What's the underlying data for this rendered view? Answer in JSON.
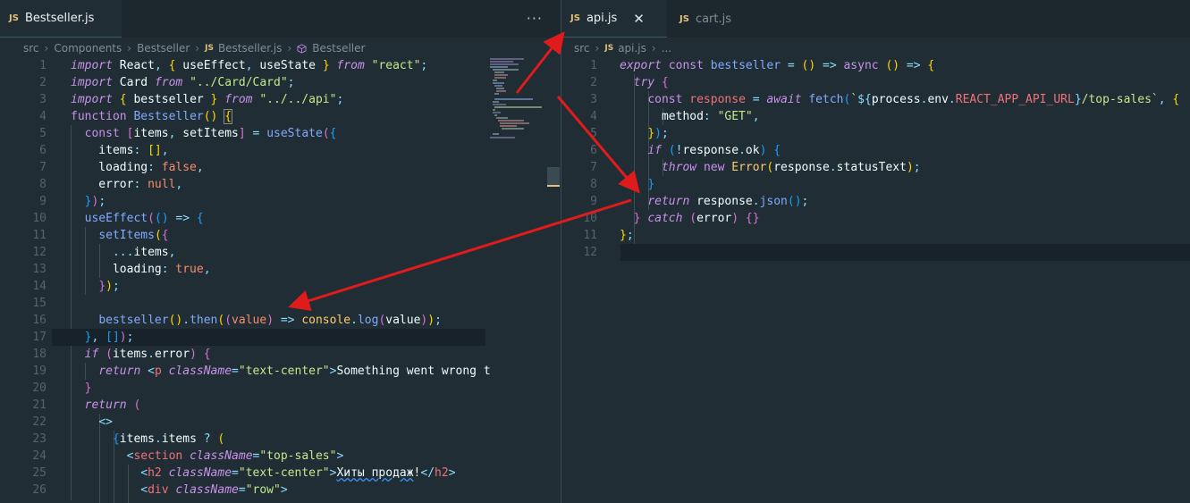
{
  "left_editor": {
    "tabs": [
      {
        "label": "Bestseller.js",
        "icon": "JS"
      }
    ],
    "more_actions": "···",
    "breadcrumb": [
      "src",
      "Components",
      "Bestseller",
      "Bestseller.js",
      "Bestseller"
    ],
    "line_numbers": [
      "1",
      "2",
      "3",
      "4",
      "5",
      "6",
      "7",
      "8",
      "9",
      "10",
      "11",
      "12",
      "13",
      "14",
      "15",
      "16",
      "17",
      "18",
      "19",
      "20",
      "21",
      "22",
      "23",
      "24",
      "25",
      "26"
    ],
    "lines": [
      "import React, { useEffect, useState } from \"react\";",
      "import Card from \"../Card/Card\";",
      "import { bestseller } from \"../../api\";",
      "function Bestseller() {",
      "  const [items, setItems] = useState({",
      "    items: [],",
      "    loading: false,",
      "    error: null,",
      "  });",
      "  useEffect(() => {",
      "    setItems({",
      "      ...items,",
      "      loading: true,",
      "    });",
      "",
      "    bestseller().then((value) => console.log(value));",
      "  }, []);",
      "  if (items.error) {",
      "    return <p className=\"text-center\">Something went wrong t",
      "  }",
      "  return (",
      "    <>",
      "      {items.items ? (",
      "        <section className=\"top-sales\">",
      "          <h2 className=\"text-center\">Хиты продаж!</h2>",
      "          <div className=\"row\">"
    ]
  },
  "right_editor": {
    "tabs": [
      {
        "label": "api.js",
        "icon": "JS",
        "active": true
      },
      {
        "label": "cart.js",
        "icon": "JS",
        "active": false
      }
    ],
    "close_glyph": "✕",
    "breadcrumb": [
      "src",
      "api.js",
      "..."
    ],
    "line_numbers": [
      "1",
      "2",
      "3",
      "4",
      "5",
      "6",
      "7",
      "8",
      "9",
      "10",
      "11",
      "12"
    ],
    "lines": [
      "export const bestseller = () => async () => {",
      "  try {",
      "    const response = await fetch(`${process.env.REACT_APP_API_URL}/top-sales`, {",
      "      method: \"GET\",",
      "    });",
      "    if (!response.ok) {",
      "      throw new Error(response.statusText);",
      "    }",
      "    return response.json();",
      "  } catch (error) {}",
      "};",
      ""
    ]
  },
  "colors": {
    "background": "#212d34",
    "annotation_arrow": "#e01b1b"
  }
}
